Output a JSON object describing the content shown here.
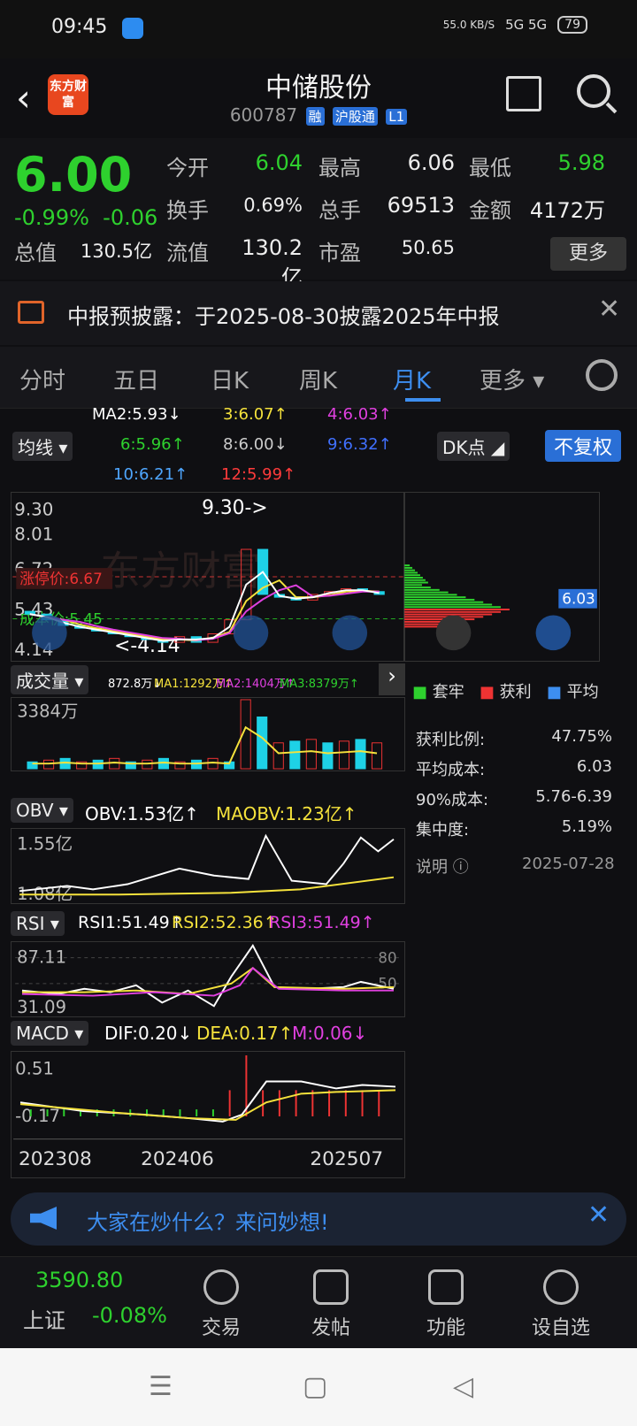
{
  "status_bar": {
    "time": "09:45",
    "net_speed": "55.0 KB/S",
    "signal": "5G 5G",
    "battery": "79"
  },
  "header": {
    "back": "‹",
    "logo": "东方财富",
    "title": "中储股份",
    "code": "600787",
    "tags": [
      "融",
      "沪股通",
      "L1"
    ]
  },
  "quote": {
    "price": "6.00",
    "change_pct": "-0.99%",
    "change": "-0.06",
    "rows": [
      [
        {
          "label": "今开",
          "value": "6.04"
        },
        {
          "label": "最高",
          "value": "6.06"
        },
        {
          "label": "最低",
          "value": "5.98"
        }
      ],
      [
        {
          "label": "换手",
          "value": "0.69%"
        },
        {
          "label": "总手",
          "value": "69513"
        },
        {
          "label": "金额",
          "value": "4172万"
        }
      ],
      [
        {
          "label": "总值",
          "value": "130.5亿"
        },
        {
          "label": "流值",
          "value": "130.2亿"
        },
        {
          "label": "市盈",
          "value": "50.65"
        }
      ]
    ],
    "more": "更多"
  },
  "notice": {
    "text": "中报预披露：于2025-08-30披露2025年中报"
  },
  "tabs": [
    "分时",
    "五日",
    "日K",
    "周K",
    "月K",
    "更多"
  ],
  "ma": {
    "selector": "均线",
    "items": [
      {
        "t": "MA2:5.93↓",
        "c": "#ffffff"
      },
      {
        "t": "3:6.07↑",
        "c": "#f5e23c"
      },
      {
        "t": "4:6.03↑",
        "c": "#e040e0"
      },
      {
        "t": "6:5.96↑",
        "c": "#2ed12e"
      },
      {
        "t": "8:6.00↓",
        "c": "#cccccc"
      },
      {
        "t": "9:6.32↑",
        "c": "#4070ff"
      },
      {
        "t": "10:6.21↑",
        "c": "#4fa7ff"
      },
      {
        "t": "12:5.99↑",
        "c": "#ff3b3b"
      }
    ],
    "dk": "DK点",
    "fq": "不复权"
  },
  "kline": {
    "yticks": [
      "9.30",
      "8.01",
      "6.72",
      "5.43",
      "4.14"
    ],
    "high_label": "9.30->",
    "low_label": "<-4.14",
    "limit_up": "涨停价:6.67",
    "cost_line": "成本价:5.45",
    "watermark": "东方财富"
  },
  "chart_data": {
    "type": "candlestick",
    "monthly_close": [
      5.3,
      5.1,
      4.9,
      4.8,
      4.7,
      4.6,
      4.5,
      4.4,
      4.3,
      4.5,
      4.3,
      4.6,
      5.1,
      7.6,
      6.0,
      5.9,
      5.8,
      6.0,
      6.1,
      6.2,
      6.1,
      6.0
    ],
    "volume_label": "成交量",
    "volume_max": "3384万",
    "volume_legend": [
      "872.8万↓",
      "MA1:1292万↑",
      "MA2:1404万↑",
      "MA3:8379万↑"
    ]
  },
  "chip": {
    "price": "6.03",
    "legend": [
      "套牢",
      "获利",
      "平均"
    ],
    "stats": [
      {
        "k": "获利比例:",
        "v": "47.75%"
      },
      {
        "k": "平均成本:",
        "v": "6.03"
      },
      {
        "k": "90%成本:",
        "v": "5.76-6.39"
      },
      {
        "k": "集中度:",
        "v": "5.19%"
      }
    ],
    "note": "说明",
    "date": "2025-07-28"
  },
  "obv": {
    "name": "OBV",
    "v1": "OBV:1.53亿↑",
    "v2": "MAOBV:1.23亿↑",
    "yt": [
      "1.55亿",
      "1.08亿"
    ]
  },
  "rsi": {
    "name": "RSI",
    "r1": "RSI1:51.49↑",
    "r2": "RSI2:52.36↑",
    "r3": "RSI3:51.49↑",
    "yt": [
      "87.11",
      "31.09"
    ],
    "lv": [
      "80",
      "50"
    ]
  },
  "macd": {
    "name": "MACD",
    "dif": "DIF:0.20↓",
    "dea": "DEA:0.17↑",
    "m": "M:0.06↓",
    "yt": [
      "0.51",
      "-0.17"
    ]
  },
  "xaxis": [
    "202308",
    "202406",
    "202507"
  ],
  "ask": {
    "text": "大家在炒什么？来问妙想!"
  },
  "bottom": {
    "index_value": "3590.80",
    "index_name": "上证",
    "index_chg": "-0.08%",
    "items": [
      "交易",
      "发帖",
      "功能",
      "设自选"
    ]
  }
}
